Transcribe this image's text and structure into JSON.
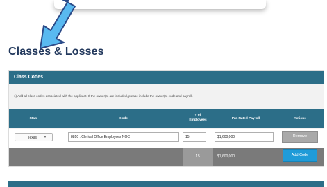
{
  "page": {
    "title": "Classes & Losses"
  },
  "colors": {
    "header_teal": "#2c6e88",
    "title_navy": "#23395d",
    "arrow_blue": "#59b9f0",
    "add_button": "#1f9bd8",
    "remove_button": "#a9a9a9",
    "total_row": "#7a7a7a"
  },
  "class_codes": {
    "panel_title": "Class Codes",
    "instructions": "1) Add all class codes associated with the applicant. If the owner(s) are included, please include the owner(s) code and payroll.",
    "columns": {
      "state": "State",
      "code": "Code",
      "employees_line1": "# of",
      "employees_line2": "Employees",
      "payroll": "Pro-Rated Payroll",
      "actions": "Actions"
    },
    "row": {
      "state": "Texas",
      "code": "8810 : Clerical Office Employees NOC",
      "employees": "15",
      "payroll": "$1,600,000",
      "remove_label": "Remove"
    },
    "totals": {
      "employees": "15",
      "payroll": "$1,600,000",
      "add_label": "Add Code"
    }
  },
  "icons": {
    "pointer": "arrow-icon",
    "dropdown": "chevron-down-icon"
  }
}
